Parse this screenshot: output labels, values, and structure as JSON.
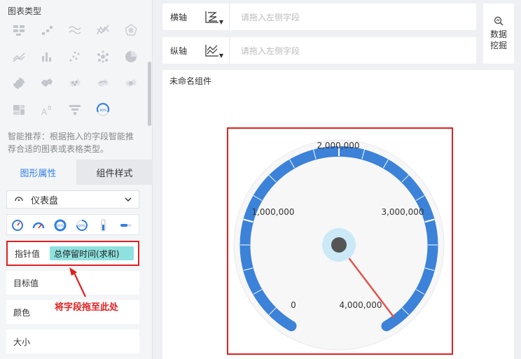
{
  "left_panel": {
    "chart_type_title": "图表类型",
    "smart_recommend": "智能推荐：根据拖入的字段智能推荐合适的图表或表格类型。",
    "tabs": [
      {
        "label": "图形属性",
        "active": true
      },
      {
        "label": "组件样式",
        "active": false
      }
    ],
    "gauge_select": {
      "label": "仪表盘"
    },
    "fields": {
      "pointer_label": "指针值",
      "pointer_value": "总停留时间(求和)",
      "target_label": "目标值",
      "color_label": "颜色",
      "size_label": "大小"
    },
    "annotation": "将字段拖至此处"
  },
  "axes": {
    "x_label": "横轴",
    "x_placeholder": "请拖入左侧字段",
    "y_label": "纵轴",
    "y_placeholder": "请拖入左侧字段"
  },
  "data_mining": {
    "label": "数据挖掘"
  },
  "canvas": {
    "component_title": "未命名组件",
    "gauge_ticks": [
      "0",
      "1,000,000",
      "2,000,000",
      "3,000,000",
      "4,000,000"
    ]
  },
  "colors": {
    "accent": "#2f7fe0",
    "gauge_blue": "#3b82d8",
    "highlight_red": "#e02020",
    "pill": "#8ee1de"
  }
}
